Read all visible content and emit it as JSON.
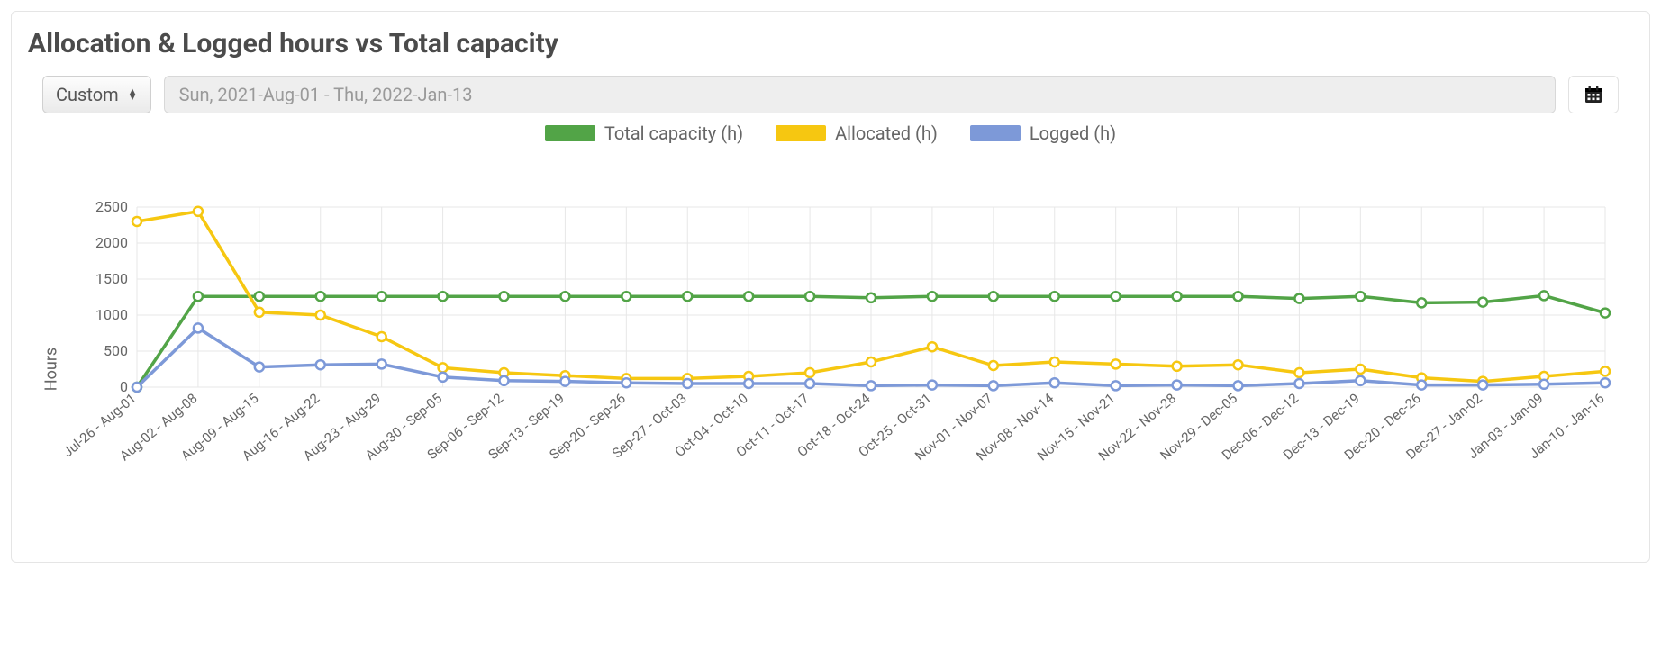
{
  "title": "Allocation & Logged hours vs Total capacity",
  "range_selector": {
    "label": "Custom"
  },
  "date_range_display": "Sun, 2021-Aug-01 - Thu, 2022-Jan-13",
  "legend": {
    "total": "Total capacity (h)",
    "allocated": "Allocated (h)",
    "logged": "Logged (h)"
  },
  "ylabel": "Hours",
  "colors": {
    "total": "#52a447",
    "allocated": "#f6c711",
    "logged": "#7d99d8"
  },
  "chart_data": {
    "type": "line",
    "ylabel": "Hours",
    "ylim": [
      0,
      2500
    ],
    "yticks": [
      0,
      500,
      1000,
      1500,
      2000,
      2500
    ],
    "categories": [
      "Jul-26 - Aug-01",
      "Aug-02 - Aug-08",
      "Aug-09 - Aug-15",
      "Aug-16 - Aug-22",
      "Aug-23 - Aug-29",
      "Aug-30 - Sep-05",
      "Sep-06 - Sep-12",
      "Sep-13 - Sep-19",
      "Sep-20 - Sep-26",
      "Sep-27 - Oct-03",
      "Oct-04 - Oct-10",
      "Oct-11 - Oct-17",
      "Oct-18 - Oct-24",
      "Oct-25 - Oct-31",
      "Nov-01 - Nov-07",
      "Nov-08 - Nov-14",
      "Nov-15 - Nov-21",
      "Nov-22 - Nov-28",
      "Nov-29 - Dec-05",
      "Dec-06 - Dec-12",
      "Dec-13 - Dec-19",
      "Dec-20 - Dec-26",
      "Dec-27 - Jan-02",
      "Jan-03 - Jan-09",
      "Jan-10 - Jan-16"
    ],
    "series": [
      {
        "name": "Total capacity (h)",
        "color": "#52a447",
        "values": [
          0,
          1260,
          1260,
          1260,
          1260,
          1260,
          1260,
          1260,
          1260,
          1260,
          1260,
          1260,
          1240,
          1260,
          1260,
          1260,
          1260,
          1260,
          1260,
          1230,
          1260,
          1170,
          1180,
          1270,
          1030
        ]
      },
      {
        "name": "Allocated (h)",
        "color": "#f6c711",
        "values": [
          2300,
          2440,
          1040,
          1000,
          700,
          270,
          200,
          160,
          120,
          120,
          150,
          200,
          350,
          560,
          300,
          350,
          320,
          290,
          310,
          200,
          250,
          130,
          80,
          150,
          220
        ]
      },
      {
        "name": "Logged (h)",
        "color": "#7d99d8",
        "values": [
          0,
          820,
          280,
          310,
          320,
          140,
          90,
          80,
          60,
          50,
          50,
          50,
          20,
          30,
          20,
          60,
          20,
          30,
          20,
          50,
          90,
          30,
          30,
          40,
          60
        ]
      }
    ]
  }
}
